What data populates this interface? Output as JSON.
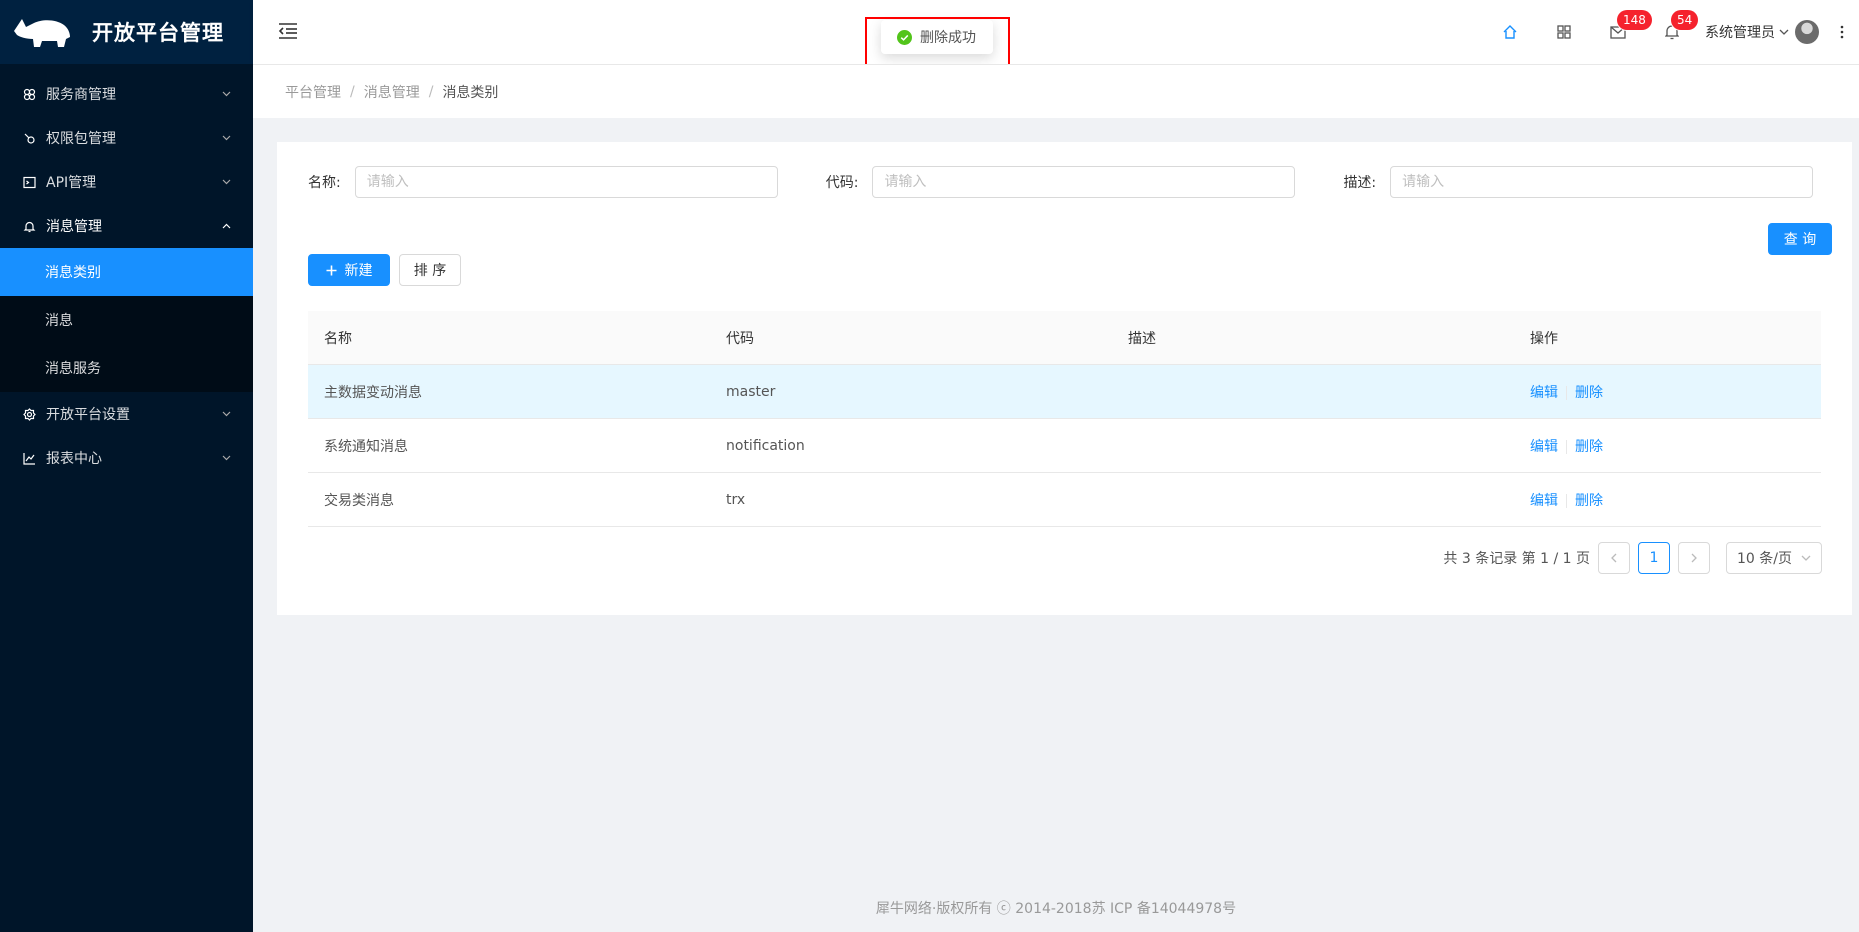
{
  "app": {
    "title": "开放平台管理"
  },
  "sidebar": {
    "items": [
      {
        "label": "服务商管理",
        "icon": "cluster-icon"
      },
      {
        "label": "权限包管理",
        "icon": "api-icon"
      },
      {
        "label": "API管理",
        "icon": "code-icon"
      },
      {
        "label": "消息管理",
        "icon": "bell-icon"
      },
      {
        "label": "开放平台设置",
        "icon": "setting-icon"
      },
      {
        "label": "报表中心",
        "icon": "line-chart-icon"
      }
    ],
    "submenu": [
      {
        "label": "消息类别"
      },
      {
        "label": "消息"
      },
      {
        "label": "消息服务"
      }
    ]
  },
  "header": {
    "mail_badge": "148",
    "bell_badge": "54",
    "username": "系统管理员"
  },
  "toast": {
    "message": "删除成功"
  },
  "breadcrumb": [
    "平台管理",
    "消息管理",
    "消息类别"
  ],
  "search": {
    "name_label": "名称:",
    "code_label": "代码:",
    "desc_label": "描述:",
    "placeholder": "请输入",
    "query_button": "查 询"
  },
  "toolbar": {
    "new_button": "新建",
    "sort_button": "排 序"
  },
  "table": {
    "columns": [
      "名称",
      "代码",
      "描述",
      "操作"
    ],
    "rows": [
      {
        "name": "主数据变动消息",
        "code": "master",
        "desc": "",
        "edit": "编辑",
        "delete": "删除"
      },
      {
        "name": "系统通知消息",
        "code": "notification",
        "desc": "",
        "edit": "编辑",
        "delete": "删除"
      },
      {
        "name": "交易类消息",
        "code": "trx",
        "desc": "",
        "edit": "编辑",
        "delete": "删除"
      }
    ]
  },
  "pagination": {
    "summary": "共 3 条记录 第 1 / 1 页",
    "current_page": "1",
    "page_size": "10 条/页"
  },
  "footer": {
    "text": "犀牛网络·版权所有 ⓒ 2014-2018苏 ICP 备14044978号"
  },
  "colors": {
    "sidebar_bg": "#001529",
    "primary": "#1890ff",
    "badge": "#f5222d",
    "highlight_frame": "#ff0000"
  }
}
